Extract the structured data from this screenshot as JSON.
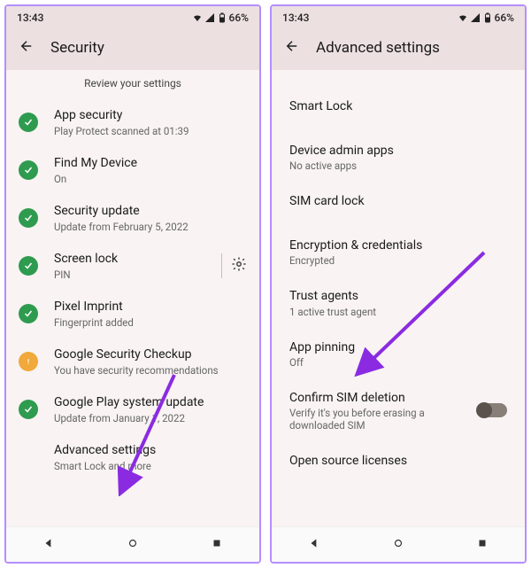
{
  "status": {
    "time": "13:43",
    "battery": "66%"
  },
  "left": {
    "title": "Security",
    "subtitle": "Review your settings",
    "items": [
      {
        "title": "App security",
        "sub": "Play Protect scanned at 01:39",
        "icon": "green"
      },
      {
        "title": "Find My Device",
        "sub": "On",
        "icon": "green"
      },
      {
        "title": "Security update",
        "sub": "Update from February 5, 2022",
        "icon": "green"
      },
      {
        "title": "Screen lock",
        "sub": "PIN",
        "icon": "green",
        "gear": true
      },
      {
        "title": "Pixel Imprint",
        "sub": "Fingerprint added",
        "icon": "green"
      },
      {
        "title": "Google Security Checkup",
        "sub": "You have security recommendations",
        "icon": "amber"
      },
      {
        "title": "Google Play system update",
        "sub": "Update from January 1, 2022",
        "icon": "green"
      },
      {
        "title": "Advanced settings",
        "sub": "Smart Lock and more",
        "icon": ""
      }
    ]
  },
  "right": {
    "title": "Advanced settings",
    "items": [
      {
        "title": "Smart Lock",
        "sub": ""
      },
      {
        "title": "Device admin apps",
        "sub": "No active apps"
      },
      {
        "title": "SIM card lock",
        "sub": ""
      },
      {
        "title": "Encryption & credentials",
        "sub": "Encrypted"
      },
      {
        "title": "Trust agents",
        "sub": "1 active trust agent"
      },
      {
        "title": "App pinning",
        "sub": "Off"
      },
      {
        "title": "Confirm SIM deletion",
        "sub": "Verify it's you before erasing a downloaded SIM",
        "toggle": true
      },
      {
        "title": "Open source licenses",
        "sub": ""
      }
    ]
  }
}
